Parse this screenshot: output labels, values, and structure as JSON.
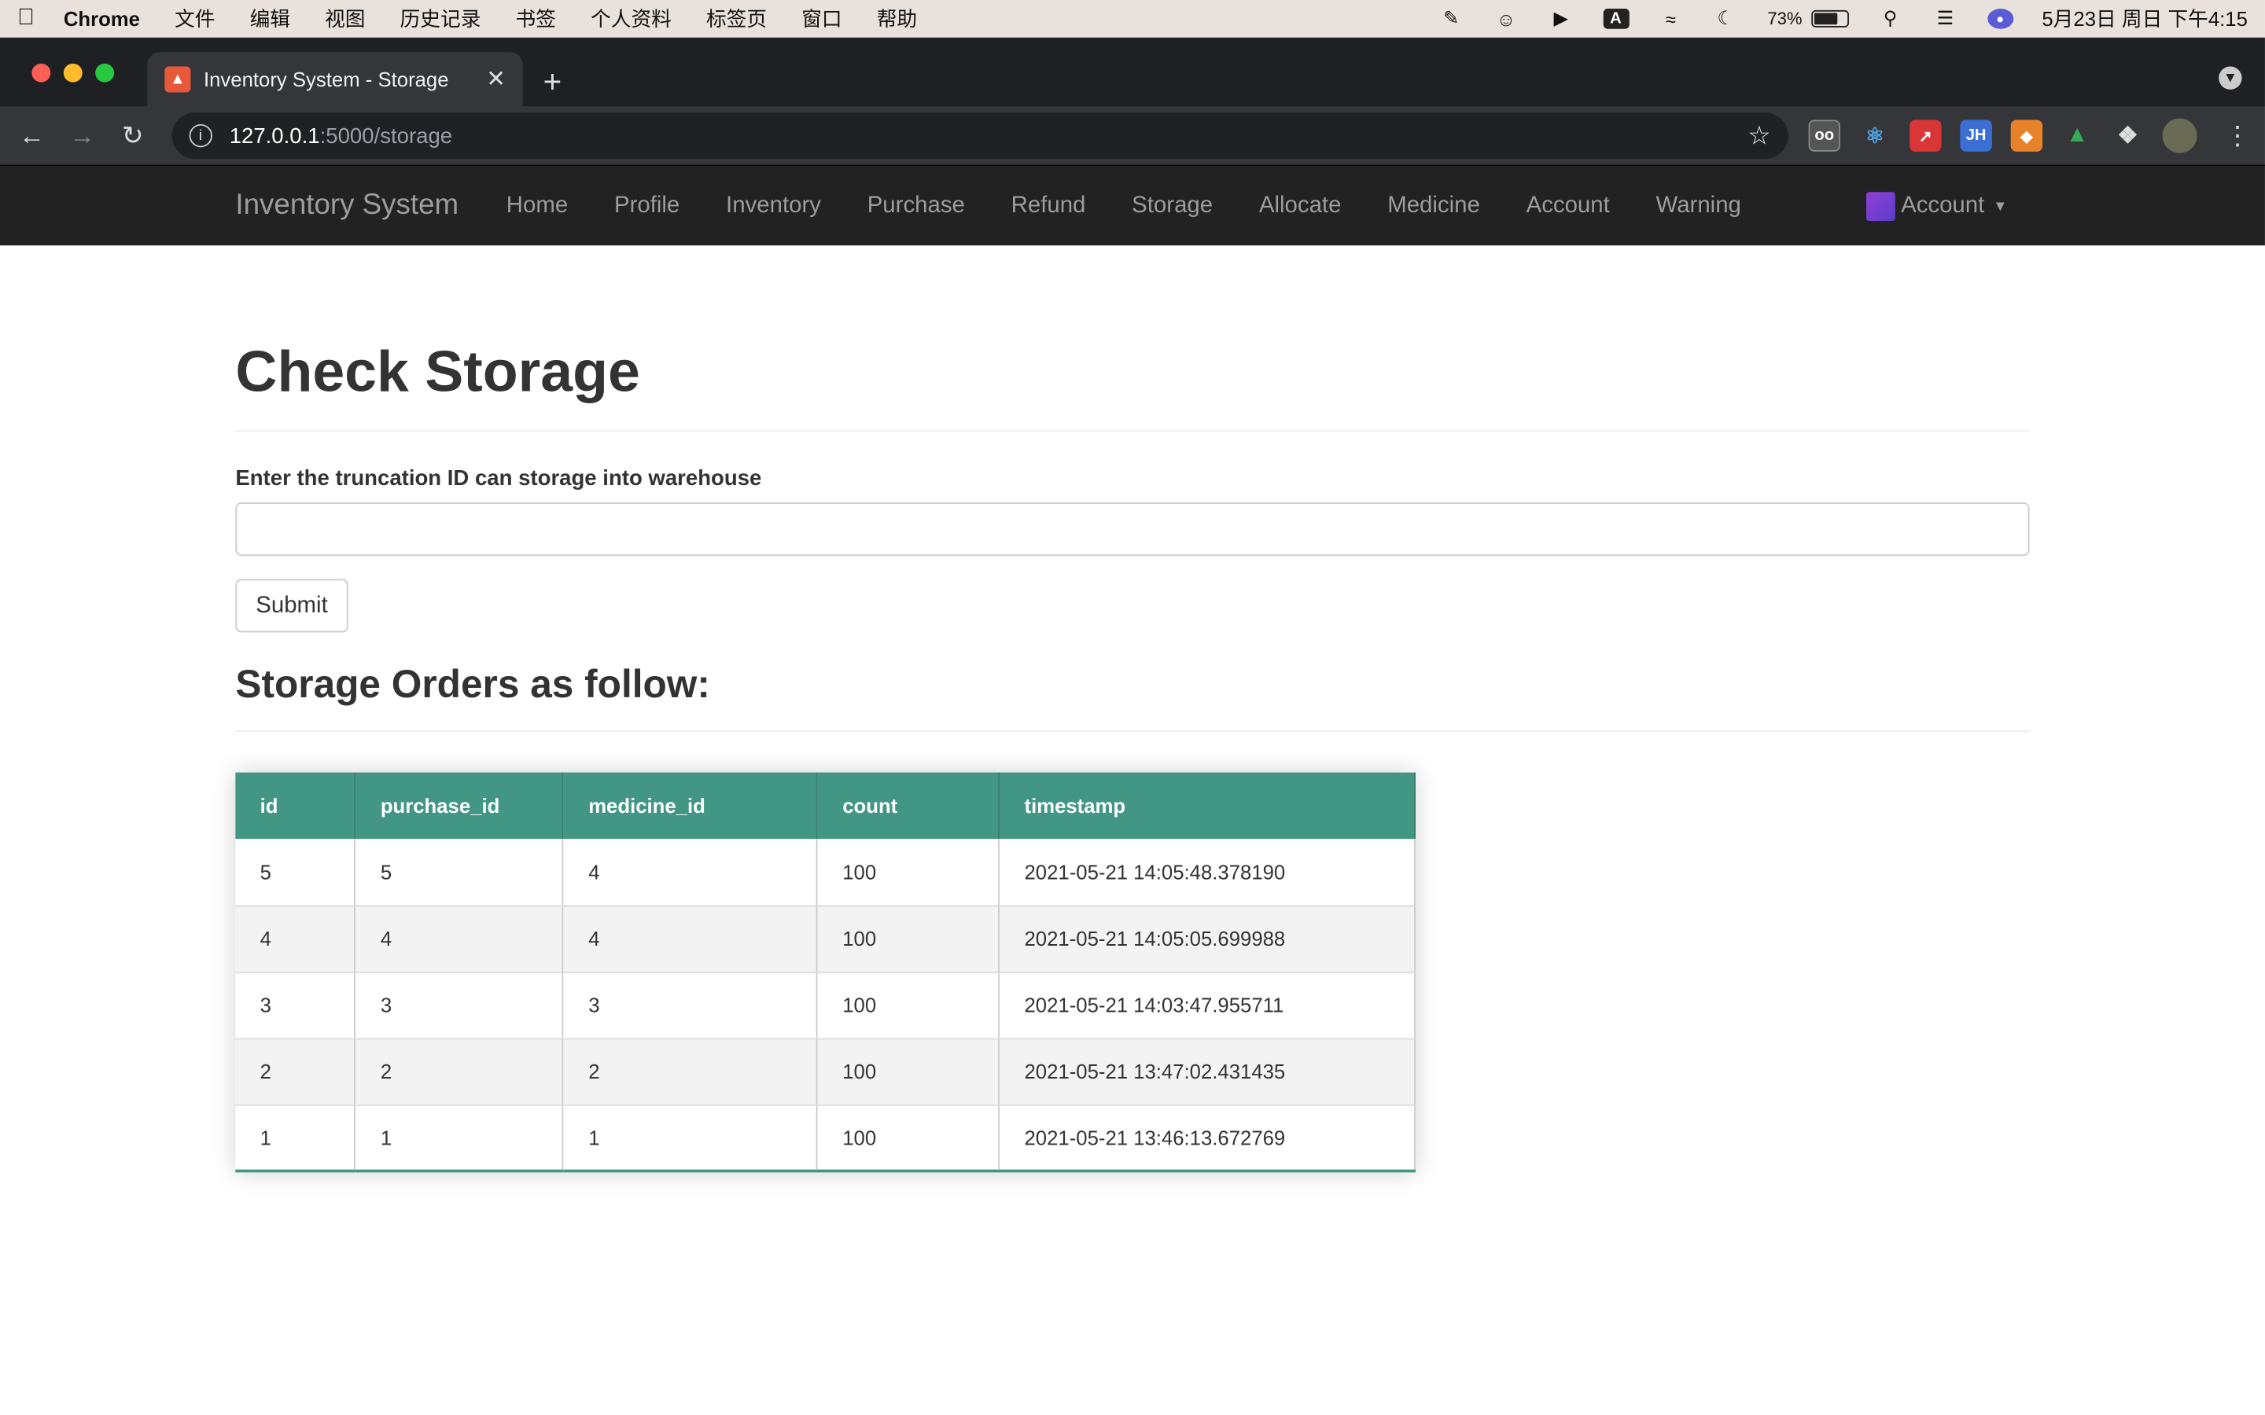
{
  "menubar": {
    "app": "Chrome",
    "items": [
      "文件",
      "编辑",
      "视图",
      "历史记录",
      "书签",
      "个人资料",
      "标签页",
      "窗口",
      "帮助"
    ],
    "battery": "73%",
    "datetime": "5月23日 周日 下午4:15"
  },
  "browser": {
    "tab_title": "Inventory System - Storage",
    "url_host": "127.0.0.1",
    "url_path": ":5000/storage"
  },
  "navbar": {
    "brand": "Inventory System",
    "links": [
      "Home",
      "Profile",
      "Inventory",
      "Purchase",
      "Refund",
      "Storage",
      "Allocate",
      "Medicine",
      "Account",
      "Warning"
    ],
    "account": "Account"
  },
  "page": {
    "title": "Check Storage",
    "input_label": "Enter the truncation ID can storage into warehouse",
    "input_value": "",
    "submit": "Submit",
    "orders_heading": "Storage Orders as follow:"
  },
  "table": {
    "columns": [
      "id",
      "purchase_id",
      "medicine_id",
      "count",
      "timestamp"
    ],
    "rows": [
      [
        "5",
        "5",
        "4",
        "100",
        "2021-05-21 14:05:48.378190"
      ],
      [
        "4",
        "4",
        "4",
        "100",
        "2021-05-21 14:05:05.699988"
      ],
      [
        "3",
        "3",
        "3",
        "100",
        "2021-05-21 14:03:47.955711"
      ],
      [
        "2",
        "2",
        "2",
        "100",
        "2021-05-21 13:47:02.431435"
      ],
      [
        "1",
        "1",
        "1",
        "100",
        "2021-05-21 13:46:13.672769"
      ]
    ]
  },
  "colors": {
    "table_header": "#429784",
    "navbar_bg": "#222222"
  }
}
